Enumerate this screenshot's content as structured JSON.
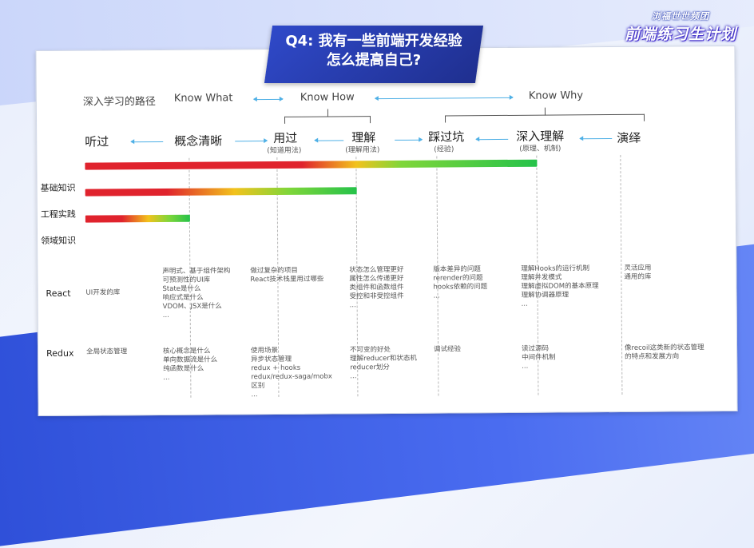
{
  "title": {
    "line1": "Q4: 我有一些前端开发经验",
    "line2": "怎么提高自己?"
  },
  "logo": {
    "small": "浏福世世频团",
    "big": "前端练习生计划"
  },
  "axis": {
    "path_label": "深入学习的路径",
    "know_what": "Know What",
    "know_how": "Know How",
    "know_why": "Know Why"
  },
  "stages": [
    {
      "label": "听过",
      "sub": ""
    },
    {
      "label": "概念清晰",
      "sub": ""
    },
    {
      "label": "用过",
      "sub": "(知道用法)"
    },
    {
      "label": "理解",
      "sub": "(理解用法)"
    },
    {
      "label": "踩过坑",
      "sub": "(经验)"
    },
    {
      "label": "深入理解",
      "sub": "(原理、机制)"
    },
    {
      "label": "演绎",
      "sub": ""
    }
  ],
  "categories": [
    "基础知识",
    "工程实践",
    "领域知识"
  ],
  "bars": [
    {
      "progress_stage": "深入理解",
      "colors": [
        "#e0232d",
        "#f2c21c",
        "#7fd63a",
        "#25c24a"
      ]
    },
    {
      "progress_stage": "理解",
      "colors": [
        "#e0232d",
        "#f2c21c",
        "#7fd63a",
        "#25c24a"
      ]
    },
    {
      "progress_stage": "概念清晰",
      "colors": [
        "#e0232d",
        "#f2c21c",
        "#7fd63a",
        "#25c24a"
      ]
    }
  ],
  "rows": {
    "react": {
      "label": "React",
      "cells": [
        "UI开发的库",
        "声明式、基于组件架构\n可预测性的UI库\nState是什么\n响应式是什么\nVDOM、JSX是什么\n...",
        "做过复杂的项目\nReact技术栈里用过哪些",
        "状态怎么管理更好\n属性怎么传递更好\n类组件和函数组件\n受控和非受控组件\n...",
        "版本差异的问题\nrerender的问题\nhooks依赖的问题\n...",
        "理解Hooks的运行机制\n理解并发模式\n理解虚拟DOM的基本原理\n理解协调器原理\n...",
        "灵活应用\n通用的库"
      ]
    },
    "redux": {
      "label": "Redux",
      "cells": [
        "全局状态管理",
        "核心概念是什么\n单向数据流是什么\n纯函数是什么\n...",
        "使用场景\n异步状态管理\nredux + hooks\nredux/redux-saga/mobx\n区别\n...",
        "不可变的好处\n理解reducer和状态机\nreducer划分\n...",
        "调试经验",
        "读过源码\n中间件机制\n...",
        "像recoil这类新的状态管理\n的特点和发展方向"
      ]
    }
  },
  "colors": {
    "accent": "#2f49c9",
    "arrow": "#4fb0e6"
  }
}
